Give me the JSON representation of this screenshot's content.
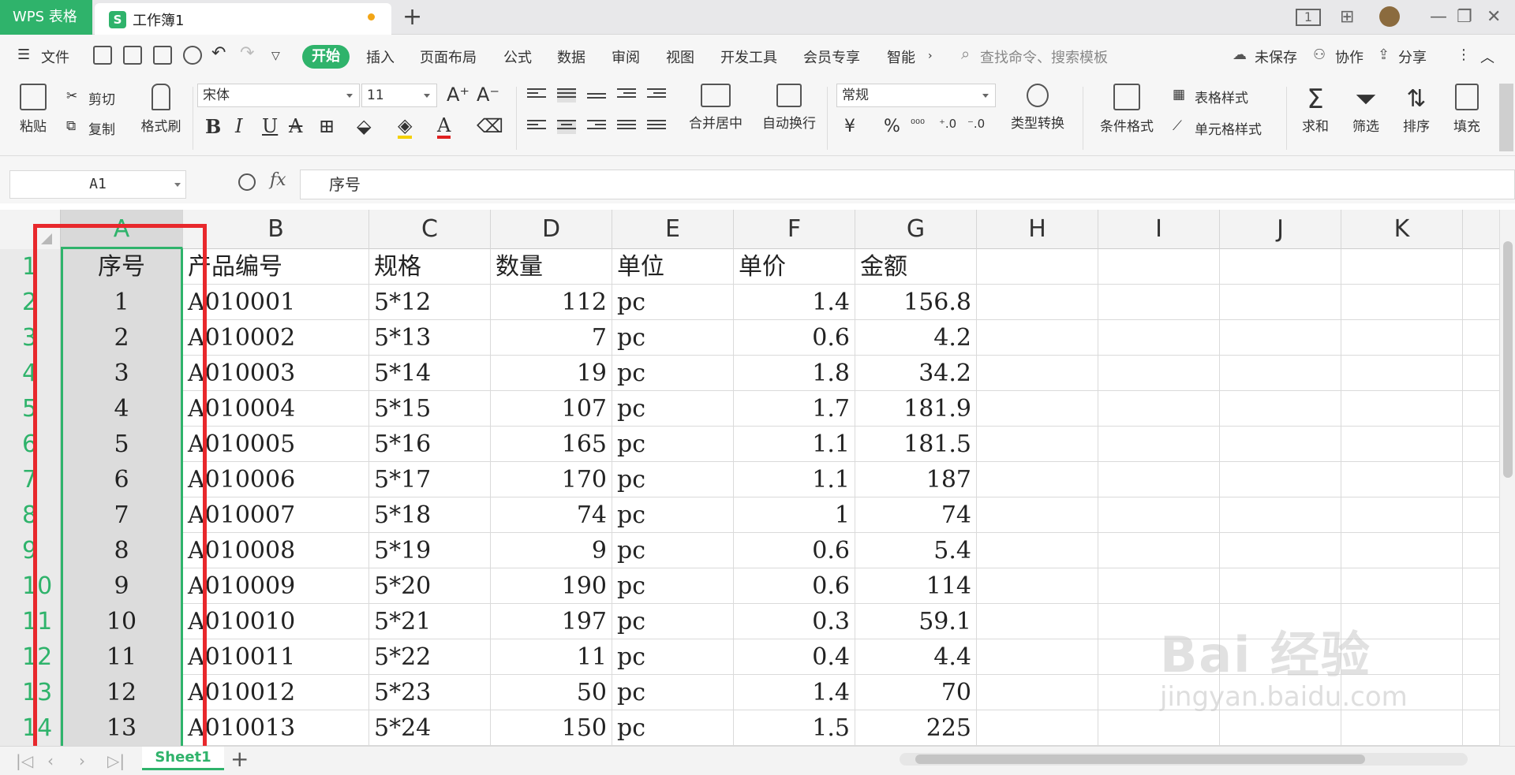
{
  "titlebar": {
    "app": "WPS 表格",
    "doc_name": "工作簿1",
    "doc_icon": "S",
    "add_tab": "+",
    "window_buttons": [
      "1",
      "⊞",
      "—",
      "❐",
      "✕"
    ]
  },
  "menu": {
    "file": "文件",
    "start": "开始",
    "tabs": [
      "插入",
      "页面布局",
      "公式",
      "数据",
      "审阅",
      "视图",
      "开发工具",
      "会员专享",
      "智能"
    ],
    "search_placeholder": "查找命令、搜索模板",
    "unsaved": "未保存",
    "collab": "协作",
    "share": "分享"
  },
  "ribbon": {
    "paste": "粘贴",
    "cut": "剪切",
    "copy": "复制",
    "format_painter": "格式刷",
    "font_name": "宋体",
    "font_size": "11",
    "merge_center": "合并居中",
    "wrap_text": "自动换行",
    "number_format": "常规",
    "type_convert": "类型转换",
    "cond_format": "条件格式",
    "table_style": "表格样式",
    "cell_style": "单元格样式",
    "sum": "求和",
    "filter": "筛选",
    "sort": "排序",
    "fill": "填充",
    "currency_symbol": "¥",
    "percent_symbol": "%"
  },
  "formula_bar": {
    "name_box": "A1",
    "fx": "fx",
    "content": "序号"
  },
  "sheet": {
    "columns": [
      "A",
      "B",
      "C",
      "D",
      "E",
      "F",
      "G",
      "H",
      "I",
      "J",
      "K"
    ],
    "row_numbers": [
      "1",
      "2",
      "3",
      "4",
      "5",
      "6",
      "7",
      "8",
      "9",
      "10",
      "11",
      "12",
      "13",
      "14"
    ],
    "header": [
      "序号",
      "产品编号",
      "规格",
      "数量",
      "单位",
      "单价",
      "金额"
    ],
    "rows": [
      [
        "1",
        "A010001",
        "5*12",
        "112",
        "pc",
        "1.4",
        "156.8"
      ],
      [
        "2",
        "A010002",
        "5*13",
        "7",
        "pc",
        "0.6",
        "4.2"
      ],
      [
        "3",
        "A010003",
        "5*14",
        "19",
        "pc",
        "1.8",
        "34.2"
      ],
      [
        "4",
        "A010004",
        "5*15",
        "107",
        "pc",
        "1.7",
        "181.9"
      ],
      [
        "5",
        "A010005",
        "5*16",
        "165",
        "pc",
        "1.1",
        "181.5"
      ],
      [
        "6",
        "A010006",
        "5*17",
        "170",
        "pc",
        "1.1",
        "187"
      ],
      [
        "7",
        "A010007",
        "5*18",
        "74",
        "pc",
        "1",
        "74"
      ],
      [
        "8",
        "A010008",
        "5*19",
        "9",
        "pc",
        "0.6",
        "5.4"
      ],
      [
        "9",
        "A010009",
        "5*20",
        "190",
        "pc",
        "0.6",
        "114"
      ],
      [
        "10",
        "A010010",
        "5*21",
        "197",
        "pc",
        "0.3",
        "59.1"
      ],
      [
        "11",
        "A010011",
        "5*22",
        "11",
        "pc",
        "0.4",
        "4.4"
      ],
      [
        "12",
        "A010012",
        "5*23",
        "50",
        "pc",
        "1.4",
        "70"
      ],
      [
        "13",
        "A010013",
        "5*24",
        "150",
        "pc",
        "1.5",
        "225"
      ]
    ],
    "tab": "Sheet1",
    "add_sheet": "+"
  },
  "watermark": {
    "logo": "Bai 经验",
    "url": "jingyan.baidu.com"
  },
  "colors": {
    "accent": "#2fb36b",
    "annotation": "#e8282c"
  }
}
